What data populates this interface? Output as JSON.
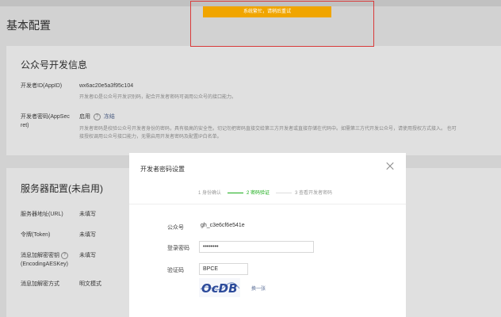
{
  "page": {
    "title": "基本配置"
  },
  "developer_info": {
    "title": "公众号开发信息",
    "appid_label": "开发者ID(AppID)",
    "appid_value": "wx6ac20e5a3f95c104",
    "appid_desc": "开发者ID是公众号开发识别码，配合开发者密码可调用公众号的接口能力。",
    "secret_label_1": "开发者密码(AppSec",
    "secret_label_2": "ret)",
    "secret_status": "启用",
    "secret_help": "?",
    "secret_freeze": "冻结",
    "secret_desc_1": "开发者密码是校验公众号开发者身份的密码，具有极高的安全性。切记勿把密码直接交给第三方开发者或直接存储在代码中。如需第三方代开发公众号，请使用授权方式接入。 也可",
    "secret_desc_2": "接授权调用公众号接口能力，无需启用开发者密码及配置IP白名单。"
  },
  "server_config": {
    "title": "服务器配置(未启用)",
    "rows": [
      {
        "label": "服务器地址(URL)",
        "value": "未填写"
      },
      {
        "label": "令牌(Token)",
        "value": "未填写"
      },
      {
        "label": "消息加解密密钥",
        "label2": "(EncodingAESKey)",
        "value": "未填写"
      },
      {
        "label": "消息加解密方式",
        "value": "明文模式"
      }
    ],
    "help": "?"
  },
  "toast": {
    "message": "系统繁忙，请稍后重试"
  },
  "modal": {
    "title": "开发者密码设置",
    "steps": [
      "1 身份确认",
      "2 密码验证",
      "3 查看开发者密码"
    ],
    "account_label": "公众号",
    "account_value": "gh_c3e6cf6e541e",
    "password_label": "登录密码",
    "password_value": "••••••••",
    "captcha_label": "验证码",
    "captcha_value": "BPCE",
    "captcha_text": "OcDB",
    "refresh_label": "换一张"
  },
  "colors": {
    "toast_bg": "#f0a500",
    "highlight_border": "#d93a3a",
    "active_step": "#1aad19",
    "link": "#576b95"
  }
}
